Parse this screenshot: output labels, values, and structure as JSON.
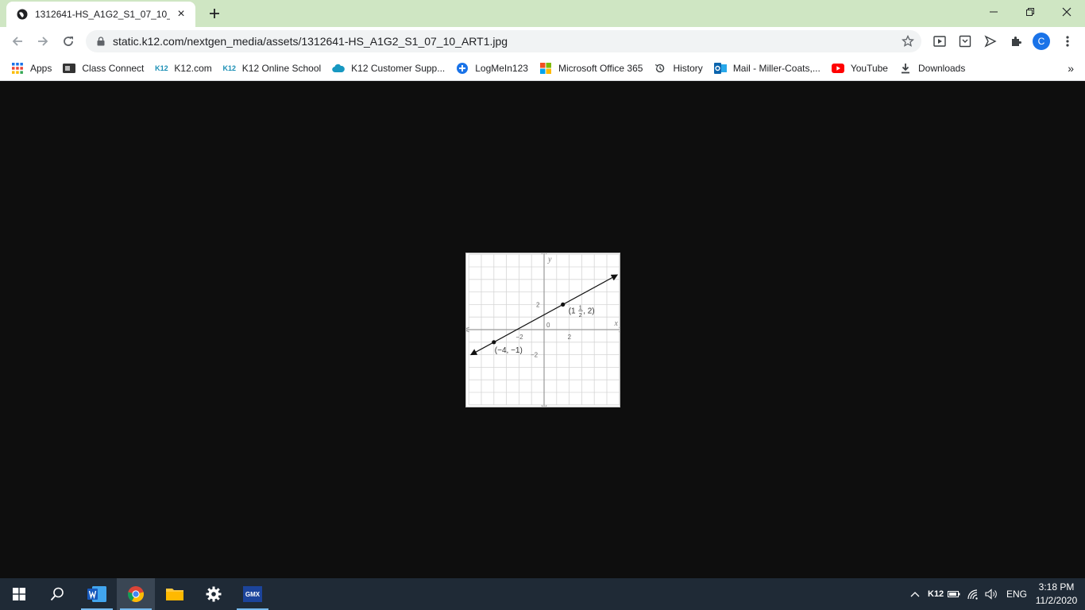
{
  "browser": {
    "tab": {
      "title": "1312641-HS_A1G2_S1_07_10_ART1.jpg"
    },
    "url": "static.k12.com/nextgen_media/assets/1312641-HS_A1G2_S1_07_10_ART1.jpg",
    "profile_initial": "C",
    "accent": "#1a73e8",
    "tabstrip_color": "#cfe6c3"
  },
  "bookmarks": [
    {
      "label": "Apps",
      "icon": "apps-grid-icon"
    },
    {
      "label": "Class Connect",
      "icon": "class-connect-icon"
    },
    {
      "label": "K12.com",
      "icon": "k12-logo-icon"
    },
    {
      "label": "K12 Online School",
      "icon": "k12-logo-icon"
    },
    {
      "label": "K12 Customer Supp...",
      "icon": "salesforce-cloud-icon"
    },
    {
      "label": "LogMeIn123",
      "icon": "logmein-icon"
    },
    {
      "label": "Microsoft Office 365",
      "icon": "microsoft-logo-icon"
    },
    {
      "label": "History",
      "icon": "history-icon"
    },
    {
      "label": "Mail - Miller-Coats,...",
      "icon": "outlook-icon"
    },
    {
      "label": "YouTube",
      "icon": "youtube-icon"
    },
    {
      "label": "Downloads",
      "icon": "download-icon"
    }
  ],
  "graph": {
    "axis_x": "x",
    "axis_y": "y",
    "tick_x_neg": "−2",
    "tick_x_pos": "2",
    "tick_y_pos": "2",
    "tick_y_neg": "−2",
    "origin": "0",
    "point_a_label": "(−4, −1)",
    "point_b_whole": "(1",
    "point_b_num": "1",
    "point_b_den": "2",
    "point_b_rest": ", 2)"
  },
  "chart_data": {
    "type": "line",
    "title": "",
    "xlabel": "x",
    "ylabel": "y",
    "xlim": [
      -6,
      6
    ],
    "ylim": [
      -6,
      6
    ],
    "grid": true,
    "series": [
      {
        "x": [
          -4,
          1.5
        ],
        "y": [
          -1,
          2
        ]
      }
    ],
    "points": [
      {
        "x": -4,
        "y": -1
      },
      {
        "x": 1.5,
        "y": 2
      }
    ]
  },
  "taskbar": {
    "clock_time": "3:18 PM",
    "clock_date": "11/2/2020",
    "language": "ENG",
    "k12_tray": "K12",
    "gmx_label": "GMX"
  }
}
